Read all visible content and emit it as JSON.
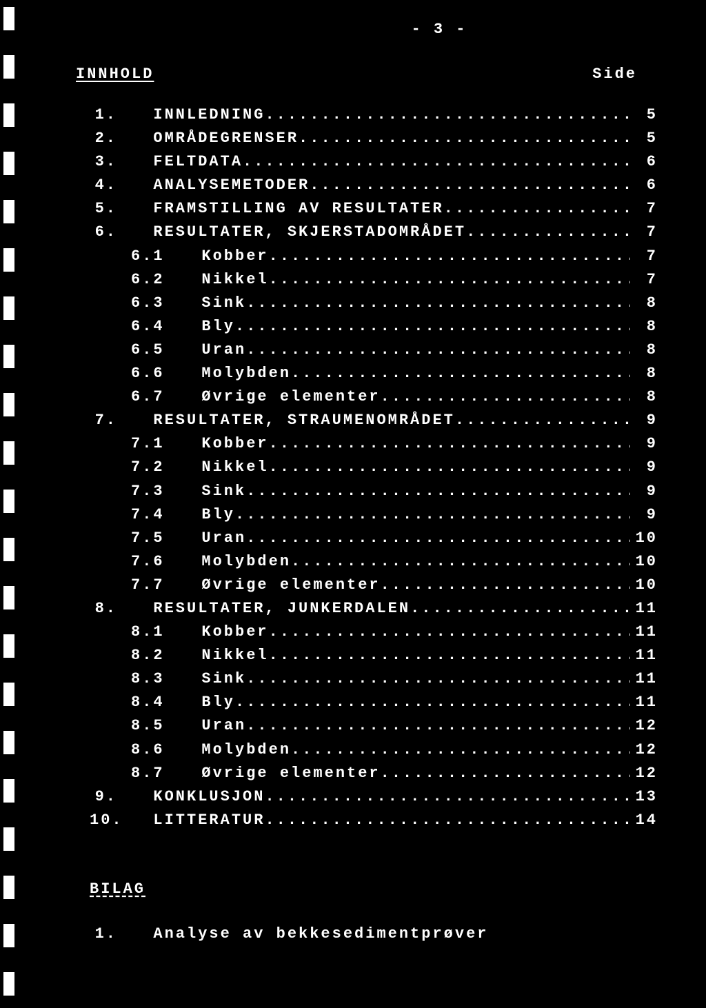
{
  "page_number": "- 3 -",
  "header": {
    "left": "INNHOLD",
    "right": "Side"
  },
  "toc": [
    {
      "num": "1.",
      "title": "INNLEDNING",
      "page": "5",
      "level": 0
    },
    {
      "num": "2.",
      "title": "OMRÅDEGRENSER",
      "page": "5",
      "level": 0
    },
    {
      "num": "3.",
      "title": "FELTDATA",
      "page": "6",
      "level": 0
    },
    {
      "num": "4.",
      "title": "ANALYSEMETODER",
      "page": "6",
      "level": 0
    },
    {
      "num": "5.",
      "title": "FRAMSTILLING AV RESULTATER",
      "page": "7",
      "level": 0
    },
    {
      "num": "6.",
      "title": "RESULTATER, SKJERSTADOMRÅDET",
      "page": "7",
      "level": 0
    },
    {
      "num": "6.1",
      "title": "Kobber",
      "page": "7",
      "level": 1
    },
    {
      "num": "6.2",
      "title": "Nikkel",
      "page": "7",
      "level": 1
    },
    {
      "num": "6.3",
      "title": "Sink",
      "page": "8",
      "level": 1
    },
    {
      "num": "6.4",
      "title": "Bly",
      "page": "8",
      "level": 1
    },
    {
      "num": "6.5",
      "title": "Uran",
      "page": "8",
      "level": 1
    },
    {
      "num": "6.6",
      "title": "Molybden",
      "page": "8",
      "level": 1
    },
    {
      "num": "6.7",
      "title": "Øvrige elementer",
      "page": "8",
      "level": 1
    },
    {
      "num": "7.",
      "title": "RESULTATER, STRAUMENOMRÅDET",
      "page": "9",
      "level": 0
    },
    {
      "num": "7.1",
      "title": "Kobber",
      "page": "9",
      "level": 1
    },
    {
      "num": "7.2",
      "title": "Nikkel",
      "page": "9",
      "level": 1
    },
    {
      "num": "7.3",
      "title": "Sink",
      "page": "9",
      "level": 1
    },
    {
      "num": "7.4",
      "title": "Bly",
      "page": "9",
      "level": 1
    },
    {
      "num": "7.5",
      "title": "Uran",
      "page": "10",
      "level": 1
    },
    {
      "num": "7.6",
      "title": "Molybden",
      "page": "10",
      "level": 1
    },
    {
      "num": "7.7",
      "title": "Øvrige elementer",
      "page": "10",
      "level": 1
    },
    {
      "num": "8.",
      "title": "RESULTATER, JUNKERDALEN",
      "page": "11",
      "level": 0
    },
    {
      "num": "8.1",
      "title": "Kobber",
      "page": "11",
      "level": 1
    },
    {
      "num": "8.2",
      "title": "Nikkel",
      "page": "11",
      "level": 1
    },
    {
      "num": "8.3",
      "title": "Sink",
      "page": "11",
      "level": 1
    },
    {
      "num": "8.4",
      "title": "Bly",
      "page": "11",
      "level": 1
    },
    {
      "num": "8.5",
      "title": "Uran",
      "page": "12",
      "level": 1
    },
    {
      "num": "8.6",
      "title": "Molybden",
      "page": "12",
      "level": 1
    },
    {
      "num": "8.7",
      "title": "Øvrige elementer",
      "page": "12",
      "level": 1
    },
    {
      "num": "9.",
      "title": "KONKLUSJON",
      "page": "13",
      "level": 0
    },
    {
      "num": "10.",
      "title": "LITTERATUR",
      "page": "14",
      "level": 0
    }
  ],
  "bilag": {
    "title": "BILAG",
    "items": [
      {
        "num": "1.",
        "title": "Analyse av bekkesedimentprøver"
      }
    ]
  }
}
